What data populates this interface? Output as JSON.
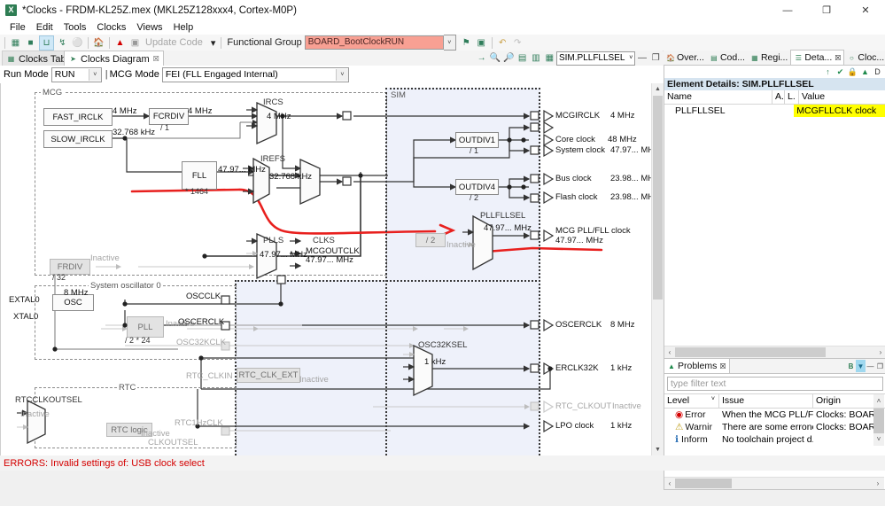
{
  "window": {
    "title": "*Clocks - FRDM-KL25Z.mex (MKL25Z128xxx4, Cortex-M0P)",
    "app_icon": "X",
    "minimize": "—",
    "maximize": "❐",
    "close": "✕"
  },
  "menu": [
    "File",
    "Edit",
    "Tools",
    "Clocks",
    "Views",
    "Help"
  ],
  "toolbar": {
    "icons": [
      "table-icon",
      "circle-icon",
      "waveform-icon",
      "pin-icon",
      "shield-icon",
      "home-icon",
      "warning-icon",
      "page-icon"
    ],
    "update_code_label": "Update Code",
    "update_code_arrow": "▾",
    "functional_group_label": "Functional Group",
    "functional_group_value": "BOARD_BootClockRUN",
    "functional_group_color": "#f8a093",
    "dropdown_arrow": "˅",
    "right_icons": [
      "flag-icon",
      "window-icon",
      "undo-icon",
      "redo-icon"
    ]
  },
  "editor": {
    "tabs": [
      {
        "label": "Clocks Table",
        "icon": "table-icon",
        "active": false
      },
      {
        "label": "Clocks Diagram",
        "icon": "diagram-icon",
        "active": true,
        "close": "☒"
      }
    ],
    "modebar": {
      "run_mode_label": "Run Mode",
      "run_mode_value": "RUN",
      "separator": "|",
      "mcg_mode_label": "MCG Mode",
      "mcg_mode_value": "FEI (FLL Engaged Internal)",
      "dropdown_arrow": "˅"
    },
    "view_toolbar": {
      "icons": [
        "arrow-right-icon",
        "zoom-in-icon",
        "zoom-out-icon",
        "fit-page-icon",
        "fit-width-icon",
        "fit-window-icon"
      ],
      "selector_value": "SIM.PLLFLLSEL",
      "dropdown_arrow": "˅",
      "minimize": "—",
      "maximize": "❐"
    }
  },
  "diagram": {
    "groups": [
      {
        "name": "MCG",
        "label": "MCG"
      },
      {
        "name": "SIM",
        "label": "SIM"
      },
      {
        "name": "System oscillator 0",
        "label": "System oscillator 0"
      },
      {
        "name": "RTC",
        "label": "RTC"
      }
    ],
    "blocks": {
      "fast_irclk": "FAST_IRCLK",
      "slow_irclk": "SLOW_IRCLK",
      "fcrdiv": "FCRDIV",
      "fcrdiv_div": "/ 1",
      "frdiv": "FRDIV",
      "frdiv_div": "/ 32",
      "frdiv_state": "Inactive",
      "fll": "FLL",
      "fll_mul": "* 1464",
      "pll": "PLL",
      "pll_mul": "/ 2 * 24",
      "pll_state": "Inactive",
      "outdiv1": "OUTDIV1",
      "outdiv1_div": "/ 1",
      "outdiv4": "OUTDIV4",
      "outdiv4_div": "/ 2",
      "div2": "/ 2",
      "div2_state": "Inactive",
      "osc": "OSC",
      "rtc_logic": "RTC logic",
      "rtc_logic_state": "Inactive",
      "rtc_clk_ext": "RTC_CLK_EXT",
      "rtc_clk_ext_state": "Inactive"
    },
    "muxes": {
      "ircs": {
        "name": "IRCS",
        "value": "4 MHz"
      },
      "irefs": {
        "name": "IREFS",
        "value": "32.768 kHz"
      },
      "plls": {
        "name": "PLLS",
        "value": "47.97... MHz"
      },
      "clks": {
        "name": "CLKS",
        "value": "MCGOUTCLK",
        "value2": "47.97... MHz"
      },
      "pllfllsel": {
        "name": "PLLFLLSEL",
        "value": "47.97... MHz"
      },
      "osc32ksel": {
        "name": "OSC32KSEL",
        "value": "1 kHz"
      },
      "rtcclkoutsel": {
        "name": "RTCCLKOUTSEL",
        "value": "Inactive"
      },
      "clkoutsel": {
        "name": "CLKOUTSEL",
        "value": ""
      }
    },
    "wire_labels": {
      "fast_4mhz": "4 MHz",
      "fcrdiv_out_4mhz": "4 MHz",
      "slow_32k": "32.768 kHz",
      "fll_out": "47.97... MHz",
      "osc_8mhz": "8 MHz",
      "oscclk": "OSCCLK",
      "oscerclk": "OSCERCLK",
      "osc32kclk": "OSC32KCLK",
      "rtc_clkin": "RTC_CLKIN",
      "rtc1hzclk": "RTC1HzCLK",
      "extal0": "EXTAL0",
      "xtal0": "XTAL0"
    },
    "outputs": [
      {
        "name": "MCGIRCLK",
        "value": "4 MHz",
        "dim": false
      },
      {
        "name": "Core clock",
        "value": "48 MHz",
        "dim": false,
        "locked": true
      },
      {
        "name": "System clock",
        "value": "47.97... MH",
        "dim": false
      },
      {
        "name": "Bus clock",
        "value": "23.98... MH",
        "dim": false
      },
      {
        "name": "Flash clock",
        "value": "23.98... MH",
        "dim": false
      },
      {
        "name": "MCG PLL/FLL clock",
        "value": "47.97... MHz",
        "dim": false
      },
      {
        "name": "OSCERCLK",
        "value": "8 MHz",
        "dim": false
      },
      {
        "name": "ERCLK32K",
        "value": "1 kHz",
        "dim": false
      },
      {
        "name": "RTC_CLKOUT",
        "value": "Inactive",
        "dim": true
      },
      {
        "name": "LPO clock",
        "value": "1 kHz",
        "dim": false
      }
    ]
  },
  "details_view": {
    "tabs": [
      {
        "label": "Over...",
        "icon": "home-icon",
        "active": false
      },
      {
        "label": "Cod...",
        "icon": "code-icon",
        "active": false
      },
      {
        "label": "Regi...",
        "icon": "register-icon",
        "active": false
      },
      {
        "label": "Deta...",
        "icon": "details-icon",
        "active": true,
        "close": "☒"
      },
      {
        "label": "Cloc...",
        "icon": "clock-icon",
        "active": false
      }
    ],
    "win_btns": [
      "—",
      "❐"
    ],
    "toolbar_icons": [
      "collapse-icon",
      "check-icon",
      "lock-icon",
      "warning-icon",
      "d-icon"
    ],
    "header": "Element Details: SIM.PLLFLLSEL",
    "columns": [
      "Name",
      "A.",
      "L.",
      "Value"
    ],
    "rows": [
      {
        "name": "PLLFLLSEL",
        "a": "",
        "l": "",
        "value": "MCGFLLCLK clock",
        "highlight": true
      }
    ],
    "hscroll": {
      "left_arrow": "‹",
      "right_arrow": "›"
    }
  },
  "problems_view": {
    "tab_label": "Problems",
    "tab_icon": "problems-icon",
    "tab_close": "☒",
    "toolbar": [
      "B",
      "filter-icon",
      "—",
      "❐"
    ],
    "filter_placeholder": "type filter text",
    "columns": [
      "Level",
      "Issue",
      "Origin"
    ],
    "sort_arrow": "˅",
    "rows": [
      {
        "level": "Error",
        "icon": "error-icon",
        "issue": "When the MCG PLL/FL...",
        "origin": "Clocks: BOARD_E"
      },
      {
        "level": "Warnir",
        "icon": "warning-icon",
        "issue": "There are some errone...",
        "origin": "Clocks: BOARD_E"
      },
      {
        "level": "Inform",
        "icon": "info-icon",
        "issue": "No toolchain project d...",
        "origin": ""
      }
    ],
    "scroll": {
      "up": "˄",
      "down": "˅",
      "left": "‹",
      "right": "›"
    }
  },
  "status": {
    "error_text": "ERRORS: Invalid settings of: USB clock select",
    "error_color": "#d40000"
  }
}
